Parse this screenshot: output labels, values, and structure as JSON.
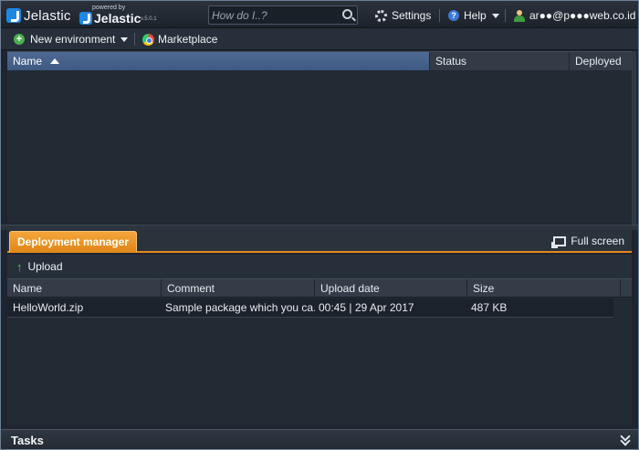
{
  "header": {
    "logo_text": "Jelastic",
    "powered_by": "powered by",
    "powered_brand": "Jelastic",
    "version": "v.5.0.1",
    "search_placeholder": "How do I..?",
    "settings_label": "Settings",
    "help_label": "Help",
    "user_email": "ar●●@p●●●web.co.id"
  },
  "toolbar": {
    "new_environment_label": "New environment",
    "marketplace_label": "Marketplace"
  },
  "environments_grid": {
    "columns": [
      "Name",
      "Status",
      "Deployed"
    ],
    "sort_column": "Name",
    "sort_direction": "ascending",
    "rows": []
  },
  "deployment_manager": {
    "tab_label": "Deployment manager",
    "full_screen_label": "Full screen",
    "upload_label": "Upload",
    "columns": [
      "Name",
      "Comment",
      "Upload date",
      "Size"
    ],
    "rows": [
      {
        "name": "HelloWorld.zip",
        "comment": "Sample package which you ca...",
        "upload_date": "00:45 | 29 Apr 2017",
        "size": "487 KB"
      }
    ]
  },
  "tasks_bar": {
    "label": "Tasks"
  },
  "colors": {
    "accent_orange": "#e8891d",
    "selected_header": "#4e6a93",
    "background": "#1e2530"
  }
}
